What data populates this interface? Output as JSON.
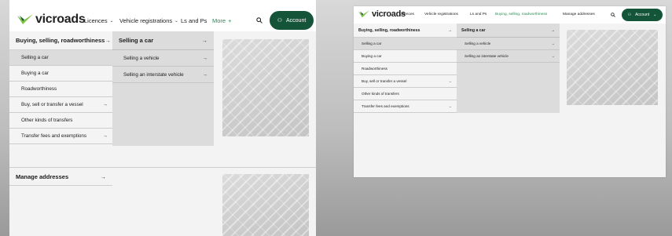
{
  "left": {
    "logo_text": "vicroads",
    "nav": [
      {
        "label": "Licences"
      },
      {
        "label": "Vehicle registrations"
      },
      {
        "label": "Ls and Ps"
      },
      {
        "label": "More"
      }
    ],
    "account_label": "Account",
    "menu_col1_header": "Buying, selling, roadworthiness",
    "menu_col1_items": [
      "Selling a car",
      "Buying a car",
      "Roadworthiness",
      "Buy, sell or transfer a vessel",
      "Other kinds of transfers",
      "Transfer fees and exemptions"
    ],
    "menu_col2_header": "Selling a car",
    "menu_col2_items": [
      "Selling a vehicle",
      "Selling an interstate vehicle"
    ],
    "manage_addresses": "Manage addresses"
  },
  "right": {
    "logo_text": "vicroads",
    "nav": [
      {
        "label": "Licences"
      },
      {
        "label": "Vehicle registrations"
      },
      {
        "label": "Ls and Ps"
      },
      {
        "label": "Buying, selling, roadworthiness"
      },
      {
        "label": "Manage addresses"
      }
    ],
    "account_label": "Account",
    "menu_col1_header": "Buying, selling, roadworthiness",
    "menu_col1_items": [
      "Selling a car",
      "Buying a car",
      "Roadworthiness",
      "Buy, sell or transfer a vessel",
      "Other kinds of transfers",
      "Transfer fees and exemptions"
    ],
    "menu_col2_header": "Selling a car",
    "menu_col2_items": [
      "Selling a vehicle",
      "Selling an interstate vehicle"
    ]
  },
  "colors": {
    "brand_green": "#14553a",
    "accent_green": "#2e8b57",
    "logo_green": "#7dc242"
  }
}
